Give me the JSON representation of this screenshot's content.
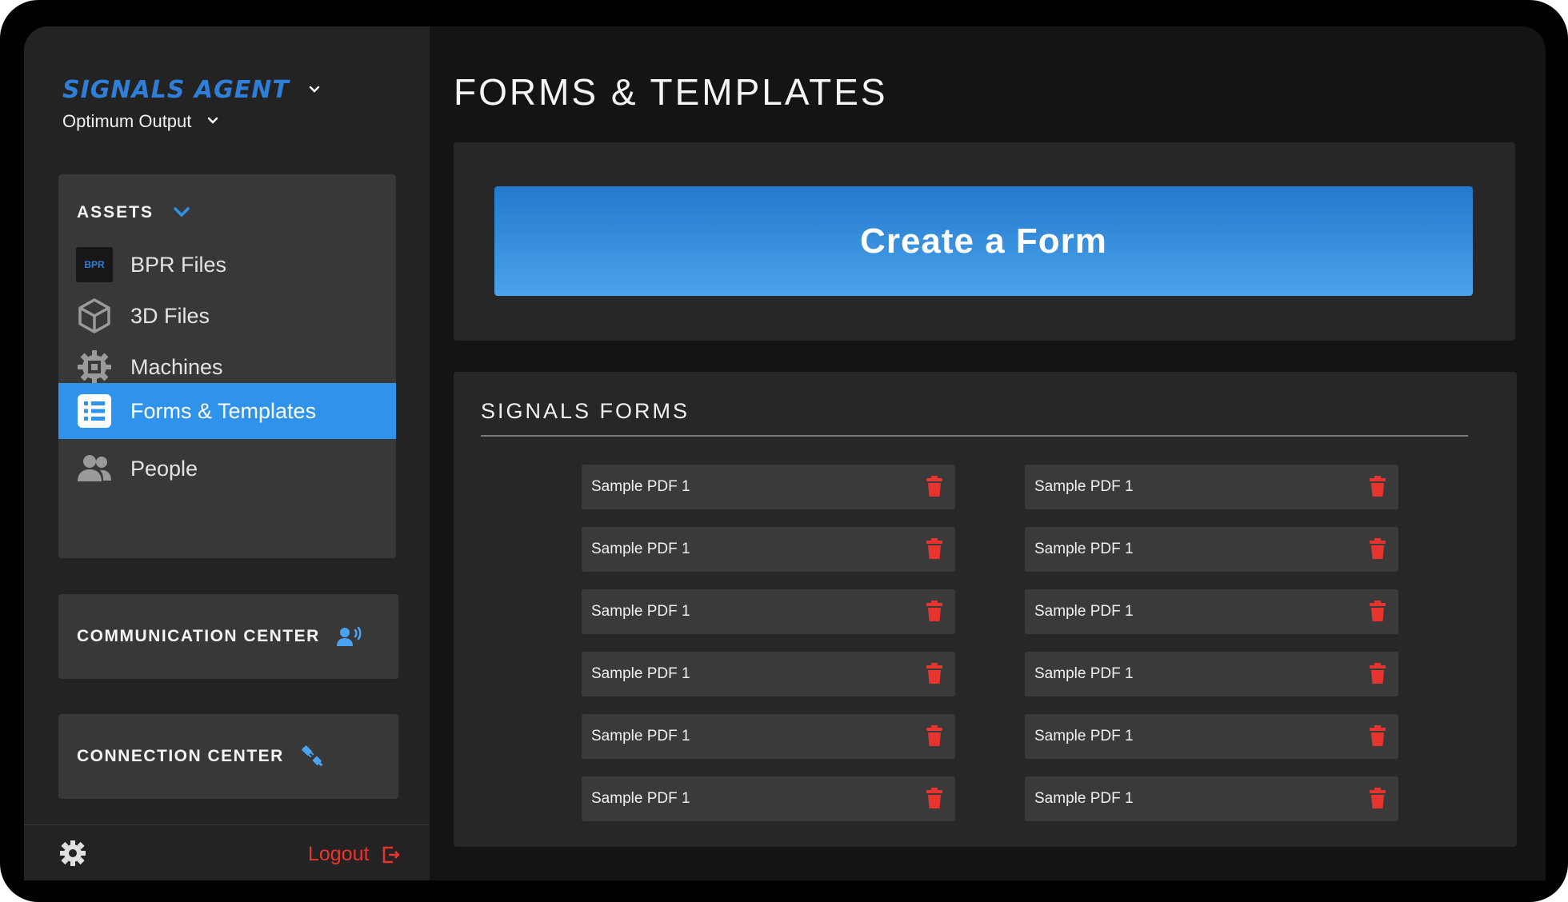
{
  "sidebar": {
    "brand": "SIGNALS AGENT",
    "organization": "Optimum Output",
    "assets": {
      "heading": "ASSETS",
      "items": [
        {
          "label": "BPR Files",
          "icon": "bpr-icon",
          "icon_text": "BPR"
        },
        {
          "label": "3D Files",
          "icon": "cube-icon"
        },
        {
          "label": "Machines",
          "icon": "cog-chip-icon"
        },
        {
          "label": "Forms & Templates",
          "icon": "list-icon",
          "active": true
        },
        {
          "label": "People",
          "icon": "people-icon"
        }
      ]
    },
    "communication_center": "COMMUNICATION CENTER",
    "connection_center": "CONNECTION CENTER",
    "logout": "Logout"
  },
  "main": {
    "title": "FORMS & TEMPLATES",
    "create_button": "Create a Form",
    "forms_heading": "SIGNALS FORMS",
    "forms": [
      "Sample PDF 1",
      "Sample PDF 1",
      "Sample PDF 1",
      "Sample PDF 1",
      "Sample PDF 1",
      "Sample PDF 1",
      "Sample PDF 1",
      "Sample PDF 1",
      "Sample PDF 1",
      "Sample PDF 1",
      "Sample PDF 1",
      "Sample PDF 1"
    ]
  },
  "colors": {
    "accent": "#2f93ec",
    "brand": "#2f7fd8",
    "danger": "#e8342f",
    "background": "#141414",
    "sidebar": "#232323",
    "panel": "#272727",
    "card": "#3a3a3a"
  }
}
